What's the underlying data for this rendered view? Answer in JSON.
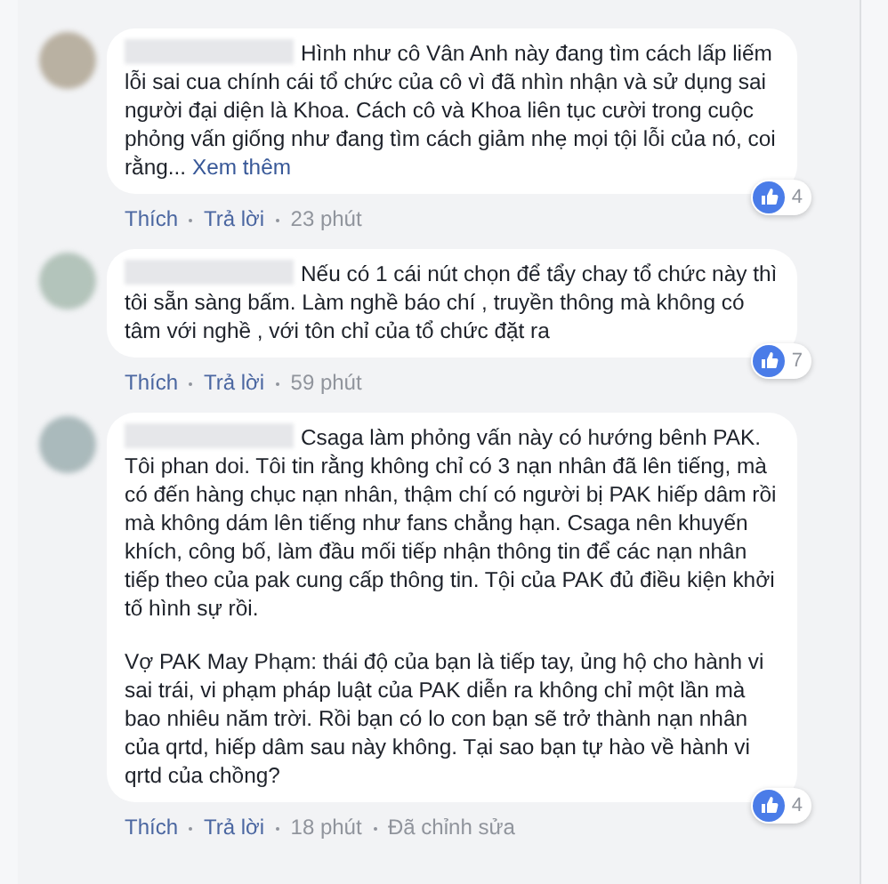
{
  "comments": [
    {
      "paragraphs": [
        "Hình như cô Vân Anh này đang tìm cách lấp liếm lỗi sai cua chính cái tổ chức của cô vì đã nhìn nhận và sử dụng sai người đại diện là Khoa. Cách cô và Khoa liên tục cười trong cuộc phỏng vấn giống như đang tìm cách giảm nhẹ mọi tội lỗi của nó, coi rằng..."
      ],
      "see_more": "Xem thêm",
      "like": "Thích",
      "reply": "Trả lời",
      "time": "23 phút",
      "reactions": "4"
    },
    {
      "paragraphs": [
        "Nếu có 1 cái nút chọn để tẩy chay tổ chức này thì tôi sẵn sàng bấm. Làm nghề báo chí , truyền thông mà không có tâm với nghề , với tôn chỉ của tổ chức đặt ra"
      ],
      "like": "Thích",
      "reply": "Trả lời",
      "time": "59 phút",
      "reactions": "7"
    },
    {
      "paragraphs": [
        "Csaga làm phỏng vấn này có hướng bênh PAK. Tôi phan doi. Tôi tin rằng không chỉ có 3 nạn nhân đã lên tiếng, mà có đến hàng chục nạn nhân, thậm chí có người bị PAK hiếp dâm rồi mà không dám lên tiếng như fans chẳng hạn. Csaga nên khuyến khích, công bố, làm đầu mối tiếp nhận thông tin để các nạn nhân tiếp theo của pak cung cấp thông tin. Tội của PAK đủ điều kiện khởi tố hình sự rồi.",
        "Vợ PAK May Phạm: thái độ của bạn là tiếp tay, ủng hộ cho hành vi sai trái, vi phạm pháp luật của PAK diễn ra không chỉ một lần mà bao nhiêu năm trời. Rồi bạn có lo con bạn sẽ trở thành nạn nhân của qrtd, hiếp dâm sau này không. Tại sao bạn tự hào về hành vi qrtd của chồng?"
      ],
      "like": "Thích",
      "reply": "Trả lời",
      "time": "18 phút",
      "edited": "Đã chỉnh sửa",
      "reactions": "4"
    }
  ]
}
